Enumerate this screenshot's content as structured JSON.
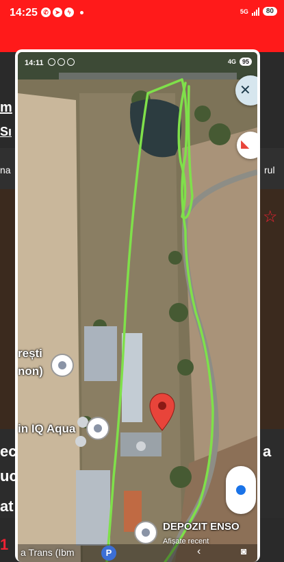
{
  "status_bar": {
    "time": "14:25",
    "network": "5G",
    "battery": "80"
  },
  "background_app": {
    "fragments": [
      "m",
      "Sı",
      "na",
      "rul",
      "ec",
      "uc",
      "at",
      "a",
      "1"
    ]
  },
  "screenshot": {
    "status": {
      "time": "14:11",
      "network": "4G",
      "battery": "95"
    },
    "map": {
      "places": [
        {
          "name": "București",
          "suffix": "(Moșnon)",
          "line1": "rești",
          "line2": "non)"
        },
        {
          "name": "in IQ Aqua"
        },
        {
          "name": "DEPOZIT ENSO",
          "sub": "Afișate recent"
        },
        {
          "name": "a Trans (Ibm"
        }
      ],
      "track_color": "#7fe04a",
      "marker_color": "#e8443a"
    }
  }
}
